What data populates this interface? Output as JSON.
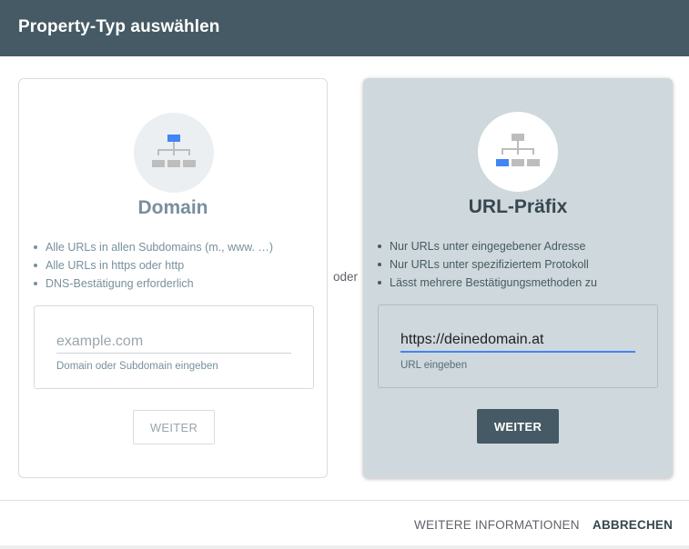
{
  "dialog": {
    "title": "Property-Typ auswählen"
  },
  "domain_card": {
    "icon": "sitemap-root-highlighted-icon",
    "title": "Domain",
    "features": [
      "Alle URLs in allen Subdomains (m., www. …)",
      "Alle URLs in https oder http",
      "DNS-Bestätigung erforderlich"
    ],
    "input": {
      "value": "",
      "placeholder": "example.com",
      "helper": "Domain oder Subdomain eingeben"
    },
    "button_label": "WEITER"
  },
  "separator_text": "oder",
  "url_card": {
    "icon": "sitemap-child-highlighted-icon",
    "title": "URL-Präfix",
    "features": [
      "Nur URLs unter eingegebener Adresse",
      "Nur URLs unter spezifiziertem Protokoll",
      "Lässt mehrere Bestätigungsmethoden zu"
    ],
    "input": {
      "value": "https://deinedomain.at",
      "placeholder": "",
      "helper": "URL eingeben"
    },
    "button_label": "WEITER"
  },
  "footer": {
    "more_info_label": "WEITERE INFORMATIONEN",
    "cancel_label": "ABBRECHEN"
  },
  "colors": {
    "header_bg": "#455a64",
    "selected_card_bg": "#cfd8dc",
    "accent_blue": "#4285f4",
    "primary_button": "#455a64"
  }
}
